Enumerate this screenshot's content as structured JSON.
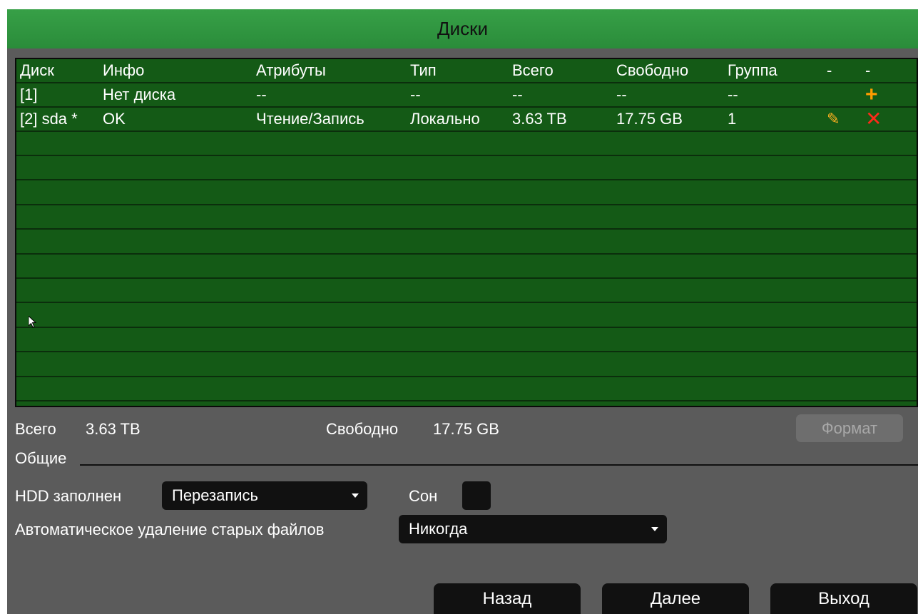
{
  "window": {
    "title": "Диски"
  },
  "table": {
    "headers": [
      "Диск",
      "Инфо",
      "Атрибуты",
      "Тип",
      "Всего",
      "Свободно",
      "Группа",
      "-",
      "-"
    ],
    "rows": [
      {
        "disk": "[1]",
        "info": "Нет диска",
        "attributes": "--",
        "type": "--",
        "total": "--",
        "free": "--",
        "group": "--",
        "action1": "",
        "action2": "+"
      },
      {
        "disk": "[2] sda *",
        "info": "OK",
        "attributes": "Чтение/Запись",
        "type": "Локально",
        "total": "3.63 TB",
        "free": "17.75 GB",
        "group": "1",
        "action1": "✎",
        "action2": "✕"
      }
    ],
    "empty_row_count": 11,
    "icons": {
      "add": "plus-icon",
      "edit": "pencil-icon",
      "delete": "close-icon"
    }
  },
  "summary": {
    "total_label": "Всего",
    "total_value": "3.63 TB",
    "free_label": "Свободно",
    "free_value": "17.75 GB",
    "format_button": "Формат"
  },
  "general": {
    "section_label": "Общие",
    "hdd_full_label": "HDD заполнен",
    "hdd_full_value": "Перезапись",
    "sleep_label": "Сон",
    "auto_delete_label": "Автоматическое удаление старых файлов",
    "auto_delete_value": "Никогда"
  },
  "buttons": {
    "back": "Назад",
    "next": "Далее",
    "exit": "Выход"
  },
  "colors": {
    "title_bar": "#2f943e",
    "table_bg": "#145a16",
    "panel_bg": "#5b5b5b",
    "add_icon": "#ff9c00",
    "delete_icon": "#ff2a1a"
  }
}
